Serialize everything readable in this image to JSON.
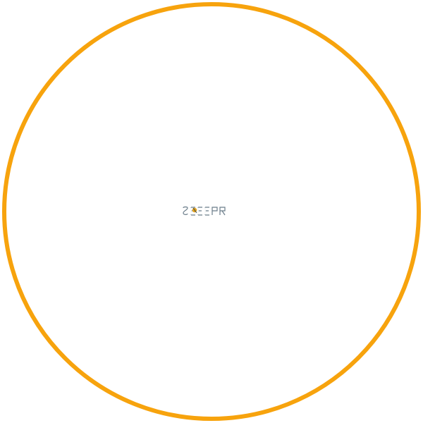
{
  "canvas": {
    "background": "#ffffff",
    "ring_color": "#f7a30d"
  },
  "logo": {
    "icon": "small-wordmark-logo",
    "text_color": "#ffffff",
    "outline_color": "#6b7d8a",
    "accent_color": "#e3a21a",
    "lettering": "SCREEN"
  }
}
